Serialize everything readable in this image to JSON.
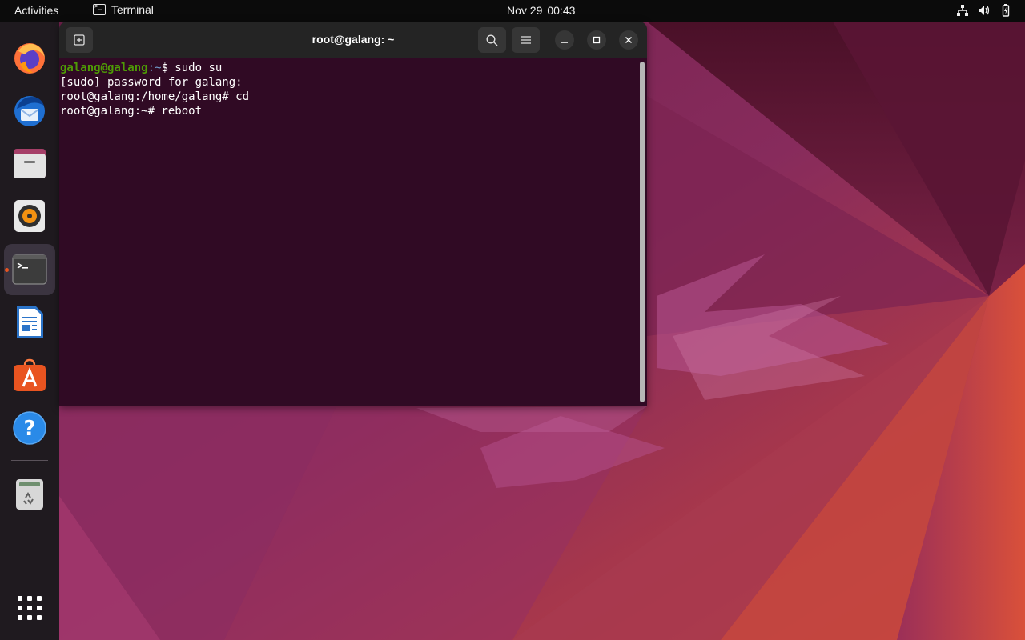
{
  "topbar": {
    "activities": "Activities",
    "app_name": "Terminal",
    "date": "Nov 29",
    "time": "00:43",
    "tray_icons": [
      "network-icon",
      "volume-icon",
      "battery-icon"
    ]
  },
  "dock": {
    "items": [
      {
        "name": "firefox",
        "icon": "firefox-icon"
      },
      {
        "name": "thunderbird",
        "icon": "thunderbird-icon"
      },
      {
        "name": "files",
        "icon": "files-icon"
      },
      {
        "name": "rhythmbox",
        "icon": "rhythmbox-icon"
      },
      {
        "name": "terminal",
        "icon": "terminal-icon",
        "active": true,
        "running": true
      },
      {
        "name": "libreoffice-writer",
        "icon": "writer-icon"
      },
      {
        "name": "ubuntu-software",
        "icon": "software-icon"
      },
      {
        "name": "help",
        "icon": "help-icon"
      },
      {
        "name": "trash",
        "icon": "trash-icon"
      }
    ],
    "show_apps_icon": "app-grid-icon"
  },
  "terminal": {
    "title": "root@galang: ~",
    "lines": [
      {
        "userhost": "galang@galang",
        "path": ":~",
        "rest": "$ sudo su"
      },
      {
        "text": "[sudo] password for galang:"
      },
      {
        "text": "root@galang:/home/galang# cd"
      },
      {
        "text": "root@galang:~# reboot"
      }
    ]
  },
  "colors": {
    "terminal_bg": "#300a24",
    "headerbar_bg": "#242424",
    "prompt_user": "#4e9a06",
    "prompt_path": "#729fcf",
    "accent": "#e95420"
  }
}
